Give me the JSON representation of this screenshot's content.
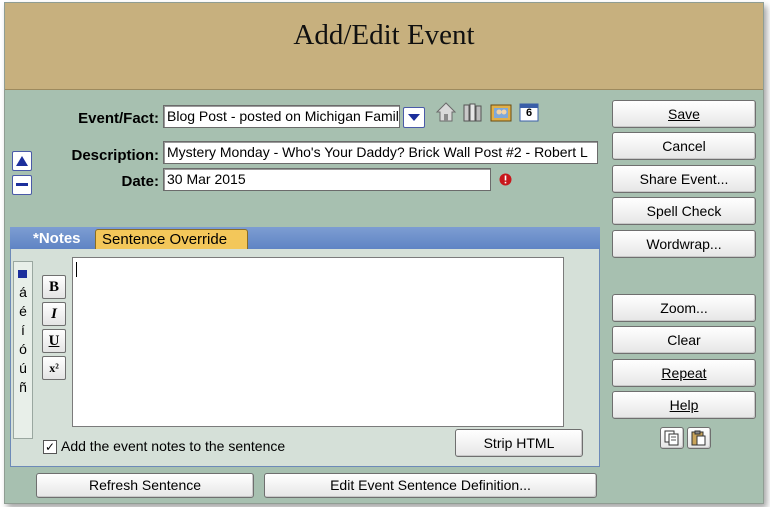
{
  "title": "Add/Edit Event",
  "form": {
    "event_label": "Event/Fact:",
    "event_value": "Blog Post - posted on Michigan Famil",
    "description_label": "Description:",
    "description_value": "Mystery Monday - Who's Your Daddy?  Brick Wall Post #2 - Robert L",
    "date_label": "Date:",
    "date_value": "30 Mar 2015",
    "calendar_day": "6"
  },
  "tabs": {
    "notes": "*Notes",
    "sentence_override": "Sentence Override"
  },
  "accent_chars": [
    "á",
    "é",
    "í",
    "ó",
    "ú",
    "ñ"
  ],
  "format_buttons": {
    "bold": "B",
    "italic": "I",
    "underline": "U",
    "superscript": "x²"
  },
  "notes": {
    "checkbox_label": "Add the event notes to the sentence",
    "checkbox_checked": true,
    "checkbox_mark": "✓",
    "strip_html": "Strip HTML"
  },
  "bottom_buttons": {
    "refresh": "Refresh Sentence",
    "edit_definition": "Edit Event Sentence Definition..."
  },
  "side_buttons": {
    "save": "Save",
    "cancel": "Cancel",
    "share": "Share Event...",
    "spell": "Spell Check",
    "wordwrap": "Wordwrap...",
    "zoom": "Zoom...",
    "clear": "Clear",
    "repeat": "Repeat",
    "help": "Help"
  },
  "icons": {
    "dropdown": "chevron-down-icon",
    "home": "home-icon",
    "books": "books-icon",
    "picture": "picture-icon",
    "calendar": "calendar-icon",
    "warning": "warning-icon",
    "move_up": "arrow-up-icon",
    "move_down": "minus-icon",
    "copy": "copy-icon",
    "paste": "paste-icon"
  },
  "colors": {
    "dialog_bg": "#a7c0b0",
    "titlebar": "#c7b07e",
    "tab_strip": "#6a8dc8",
    "accent_blue": "#1c2f9c",
    "warning_red": "#c8171c"
  }
}
